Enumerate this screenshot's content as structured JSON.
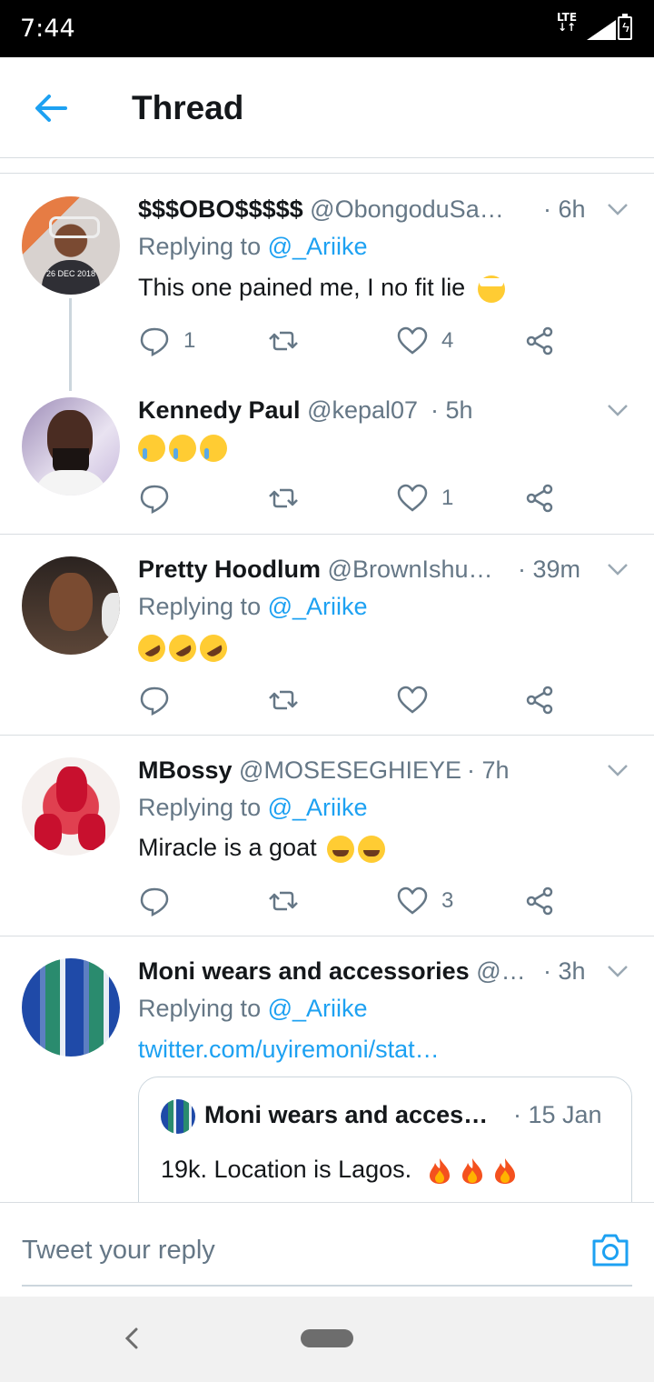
{
  "status_bar": {
    "time": "7:44",
    "network": "LTE"
  },
  "header": {
    "title": "Thread"
  },
  "tweets": [
    {
      "name": "$$$OBO$$$$$",
      "handle": "@ObongoduSa…",
      "time": "· 6h",
      "replying_prefix": "Replying to ",
      "replying_to": "@_Ariike",
      "text": "This one pained me, I no fit lie",
      "avatar_stamp": "26 DEC 2018",
      "counts": {
        "reply": "1",
        "retweet": "",
        "like": "4"
      }
    },
    {
      "name": "Kennedy Paul",
      "handle": "@kepal07",
      "time": "· 5h",
      "text": "",
      "counts": {
        "reply": "",
        "retweet": "",
        "like": "1"
      }
    },
    {
      "name": "Pretty Hoodlum",
      "handle": "@BrownIshu…",
      "time": "· 39m",
      "replying_prefix": "Replying to ",
      "replying_to": "@_Ariike",
      "text": "",
      "counts": {
        "reply": "",
        "retweet": "",
        "like": ""
      }
    },
    {
      "name": "MBossy",
      "handle": "@MOSESEGHIEYE",
      "time": "· 7h",
      "replying_prefix": "Replying to ",
      "replying_to": "@_Ariike",
      "text": "Miracle is a goat",
      "counts": {
        "reply": "",
        "retweet": "",
        "like": "3"
      }
    },
    {
      "name": "Moni wears and accessories",
      "handle": "@…",
      "time": "· 3h",
      "replying_prefix": "Replying to ",
      "replying_to": "@_Ariike",
      "link": "twitter.com/uyiremoni/stat…",
      "quote": {
        "name": "Moni wears and acces…",
        "time": "· 15 Jan",
        "text": "19k. Location is Lagos."
      }
    }
  ],
  "composer": {
    "placeholder": "Tweet your reply"
  },
  "colors": {
    "accent": "#1da1f2",
    "secondary_text": "#657786",
    "divider": "#d8dde1"
  },
  "icons": [
    "back-arrow-icon",
    "reply-icon",
    "retweet-icon",
    "like-icon",
    "share-icon",
    "chevron-down-icon",
    "camera-icon",
    "nav-back-icon",
    "home-pill"
  ]
}
